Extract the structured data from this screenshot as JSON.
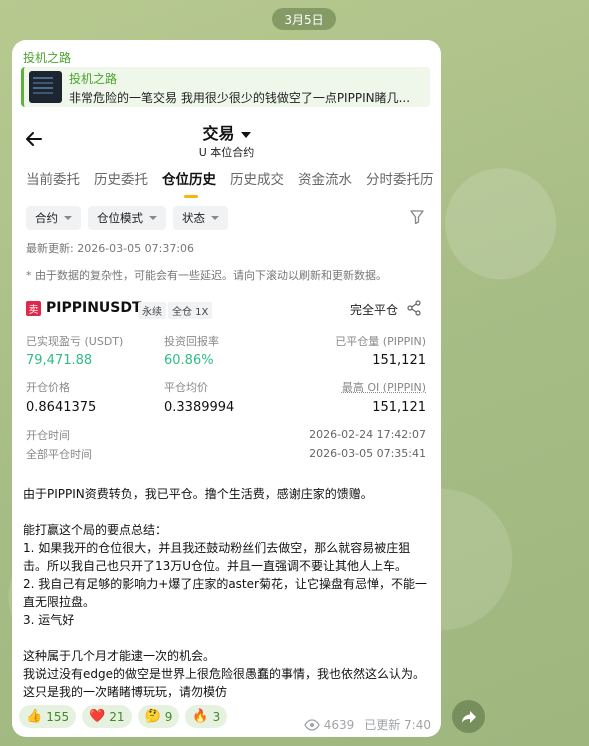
{
  "date": "3月5日",
  "channel_name": "投机之路",
  "reply": {
    "title": "投机之路",
    "text": "非常危险的一笔交易 我用很少很少的钱做空了一点PIPPIN睹几..."
  },
  "screen": {
    "title": "交易",
    "subtitle": "U 本位合约",
    "tabs": [
      "当前委托",
      "历史委托",
      "仓位历史",
      "历史成交",
      "资金流水",
      "分时委托历"
    ],
    "active_tab": "仓位历史",
    "filters": [
      "合约",
      "仓位模式",
      "状态"
    ],
    "updated": "最新更新: 2026-03-05 07:37:06",
    "notice": "* 由于数据的复杂性，可能会有一些延迟。请向下滚动以刷新和更新数据。",
    "position": {
      "side_badge": "卖",
      "symbol": "PIPPINUSDT",
      "type_tag": "永续",
      "mode_tag": "全仓 1X",
      "close_label": "完全平仓",
      "realized_pnl_label": "已实现盈亏 (USDT)",
      "realized_pnl": "79,471.88",
      "roi_label": "投资回报率",
      "roi": "60.86%",
      "closed_qty_label": "已平仓量 (PIPPIN)",
      "closed_qty": "151,121",
      "open_price_label": "开仓价格",
      "open_price": "0.8641375",
      "avg_close_label": "平仓均价",
      "avg_close": "0.3389994",
      "max_oi_label": "最高 OI (PIPPIN)",
      "max_oi": "151,121",
      "open_time_label": "开仓时间",
      "open_time": "2026-02-24 17:42:07",
      "close_time_label": "全部平仓时间",
      "close_time": "2026-03-05 07:35:41"
    }
  },
  "message": {
    "line1": "由于PIPPIN资费转负，我已平仓。撸个生活费，感谢庄家的馈赠。",
    "heading": "能打赢这个局的要点总结：",
    "point1": "1. 如果我开的仓位很大，并且我还鼓动粉丝们去做空，那么就容易被庄狙击。所以我自己也只开了13万U仓位。并且一直强调不要让其他人上车。",
    "point2": "2. 我自己有足够的影响力+爆了庄家的aster菊花，让它操盘有忌惮，不能一直无限拉盘。",
    "point3": "3. 运气好",
    "closing1": "这种属于几个月才能逮一次的机会。",
    "closing2": "我说过没有edge的做空是世界上很危险很愚蠢的事情，我也依然这么认为。这只是我的一次睹睹博玩玩，请勿模仿"
  },
  "reactions": [
    {
      "emoji": "👍",
      "count": "155"
    },
    {
      "emoji": "❤️",
      "count": "21"
    },
    {
      "emoji": "🤔",
      "count": "9"
    },
    {
      "emoji": "🔥",
      "count": "3"
    }
  ],
  "views": "4639",
  "edited_time": "已更新 7:40",
  "colors": {
    "profit_green": "#2ebd85",
    "accent_yellow": "#f0b90b",
    "sell_red": "#e0294a"
  }
}
